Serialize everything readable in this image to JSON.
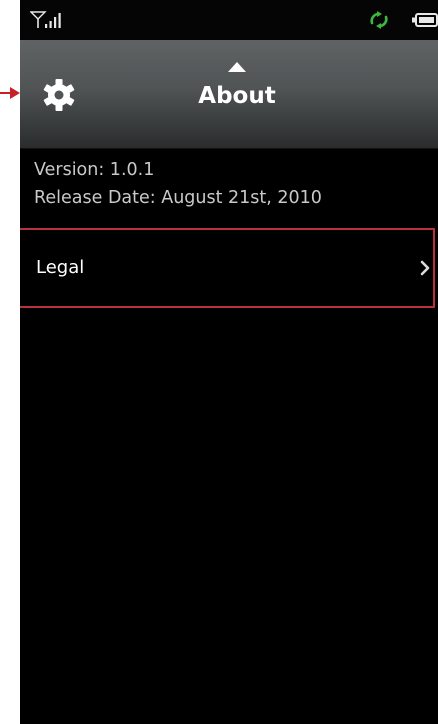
{
  "status_bar": {
    "signal_icon": "signal-strength-icon",
    "sync_icon": "sync-icon",
    "sync_color": "#3cb93c",
    "battery_icon": "battery-icon"
  },
  "header": {
    "title": "About",
    "settings_icon": "gear-icon",
    "caret_icon": "up-caret-icon",
    "background_color": "#505455"
  },
  "info": {
    "version": "Version: 1.0.1",
    "release_date": "Release Date: August 21st, 2010"
  },
  "menu": {
    "items": [
      {
        "label": "Legal",
        "icon": "chevron-right-icon"
      }
    ]
  },
  "annotation": {
    "arrow_icon": "pointer-arrow-icon",
    "highlight_color": "#b8323d"
  }
}
